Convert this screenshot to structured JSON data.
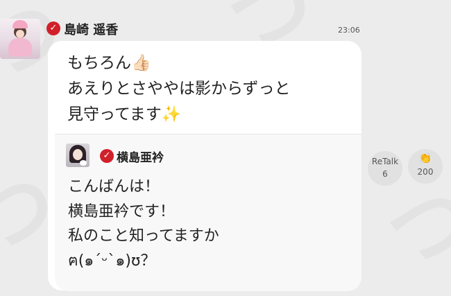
{
  "header": {
    "name": "島崎 遥香",
    "time": "23:06",
    "verified_mark": "✓"
  },
  "message": {
    "text": "もちろん👍🏻\nあえりとさややは影からずっと\n見守ってます✨"
  },
  "quoted": {
    "name": "横島亜衿",
    "verified_mark": "✓",
    "text": "こんばんは！\n横島亜衿です！\n私のこと知ってますか\nฅ(๑´ᵕ`๑)ʊ？"
  },
  "actions": {
    "retalk_label": "ReTalk",
    "retalk_count": "6",
    "clap_icon": "👏",
    "clap_count": "200"
  },
  "colors": {
    "background": "#ececec",
    "verified": "#d0202a",
    "bubble": "#ffffff"
  }
}
